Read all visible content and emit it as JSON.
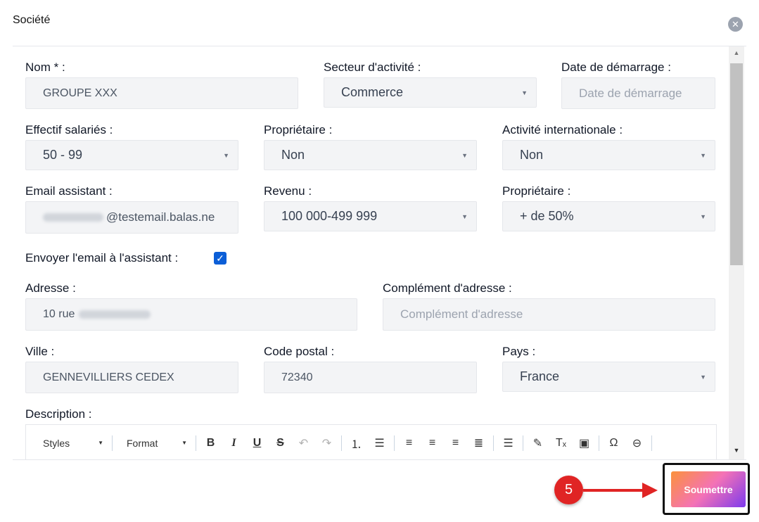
{
  "modal": {
    "title": "Société",
    "close_glyph": "✕"
  },
  "form": {
    "nom": {
      "label": "Nom * :",
      "value": "GROUPE XXX"
    },
    "secteur": {
      "label": "Secteur d'activité :",
      "value": "Commerce"
    },
    "date_demarrage": {
      "label": "Date de démarrage :",
      "placeholder": "Date de démarrage"
    },
    "effectif": {
      "label": "Effectif salariés :",
      "value": "50 - 99"
    },
    "proprietaire_1": {
      "label": "Propriétaire :",
      "value": "Non"
    },
    "activite_internationale": {
      "label": "Activité internationale :",
      "value": "Non"
    },
    "email_assistant": {
      "label": "Email assistant :",
      "value_visible": "@testemail.balas.ne"
    },
    "revenu": {
      "label": "Revenu :",
      "value": "100 000-499 999"
    },
    "proprietaire_2": {
      "label": "Propriétaire :",
      "value": "+ de 50%"
    },
    "envoyer_email": {
      "label": "Envoyer l'email à l'assistant :",
      "checked": true,
      "check_glyph": "✓"
    },
    "adresse": {
      "label": "Adresse :",
      "value_visible": "10 rue"
    },
    "complement": {
      "label": "Complément d'adresse :",
      "placeholder": "Complément d'adresse"
    },
    "ville": {
      "label": "Ville :",
      "value": "GENNEVILLIERS CEDEX"
    },
    "code_postal": {
      "label": "Code postal :",
      "value": "72340"
    },
    "pays": {
      "label": "Pays :",
      "value": "France"
    },
    "description": {
      "label": "Description :"
    }
  },
  "editor_toolbar": {
    "styles_label": "Styles",
    "format_label": "Format",
    "buttons": [
      "bold-icon",
      "italic-icon",
      "underline-icon",
      "strikethrough-icon",
      "undo-icon",
      "redo-icon",
      "numbered-list-icon",
      "bulleted-list-icon",
      "align-left-icon",
      "align-center-icon",
      "align-right-icon",
      "justify-icon",
      "horizontal-rule-icon",
      "format-painter-icon",
      "clear-format-icon",
      "paste-word-icon",
      "special-char-icon",
      "link-icon"
    ]
  },
  "annotation": {
    "step_number": "5",
    "color": "#e02424"
  },
  "footer": {
    "submit_label": "Soumettre"
  },
  "colors": {
    "checkbox": "#0b5ed7",
    "submit_gradient_start": "#fb923c",
    "submit_gradient_end": "#7c3aed"
  }
}
